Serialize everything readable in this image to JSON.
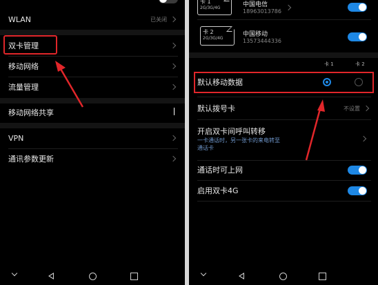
{
  "left": {
    "wlan": {
      "label": "WLAN",
      "value": "已关闭"
    },
    "dual_sim": {
      "label": "双卡管理"
    },
    "mobile_network": {
      "label": "移动网络"
    },
    "data_usage": {
      "label": "流量管理"
    },
    "hotspot": {
      "label": "移动网络共享"
    },
    "vpn": {
      "label": "VPN"
    },
    "carrier_update": {
      "label": "通讯参数更新"
    }
  },
  "right": {
    "sim1": {
      "card": "卡 1",
      "network": "2G/3G/4G",
      "carrier": "中国电信",
      "number": "18963013786",
      "enabled": true
    },
    "sim2": {
      "card": "卡 2",
      "network": "2G/3G/4G",
      "carrier": "中国移动",
      "number": "13573444336",
      "enabled": true
    },
    "column_headers": {
      "card1": "卡 1",
      "card2": "卡 2"
    },
    "default_data": {
      "label": "默认移动数据",
      "selected": "card1"
    },
    "default_dial": {
      "label": "默认拨号卡",
      "value": "不设置"
    },
    "call_forward": {
      "title": "开启双卡间呼叫转移",
      "desc_line1": "一卡通话时，另一张卡的来电转至",
      "desc_line2": "通话卡"
    },
    "call_internet": {
      "label": "通话时可上网",
      "enabled": true
    },
    "dual_4g": {
      "label": "启用双卡4G",
      "enabled": true
    }
  },
  "colors": {
    "accent": "#1e88e5",
    "highlight": "#e1262a",
    "background": "#000000"
  }
}
